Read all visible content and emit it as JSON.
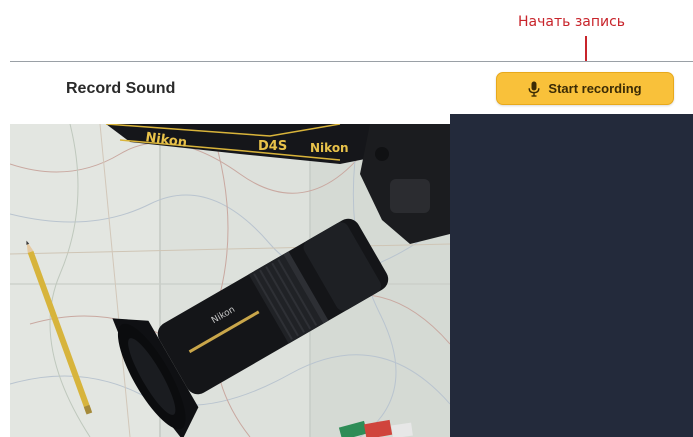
{
  "annotation": {
    "label": "Начать запись",
    "color": "#c8242b"
  },
  "header": {
    "title": "Record Sound",
    "record_button": {
      "label": "Start recording",
      "icon": "microphone-icon",
      "color": "#f9c13a"
    }
  },
  "photo": {
    "strap_text_1": "Nikon",
    "strap_text_2": "D4S",
    "strap_text_3": "Nikon",
    "lens_text": "Nikon"
  },
  "colors": {
    "panel_background": "#232a3b",
    "divider": "#9aa0a6"
  }
}
